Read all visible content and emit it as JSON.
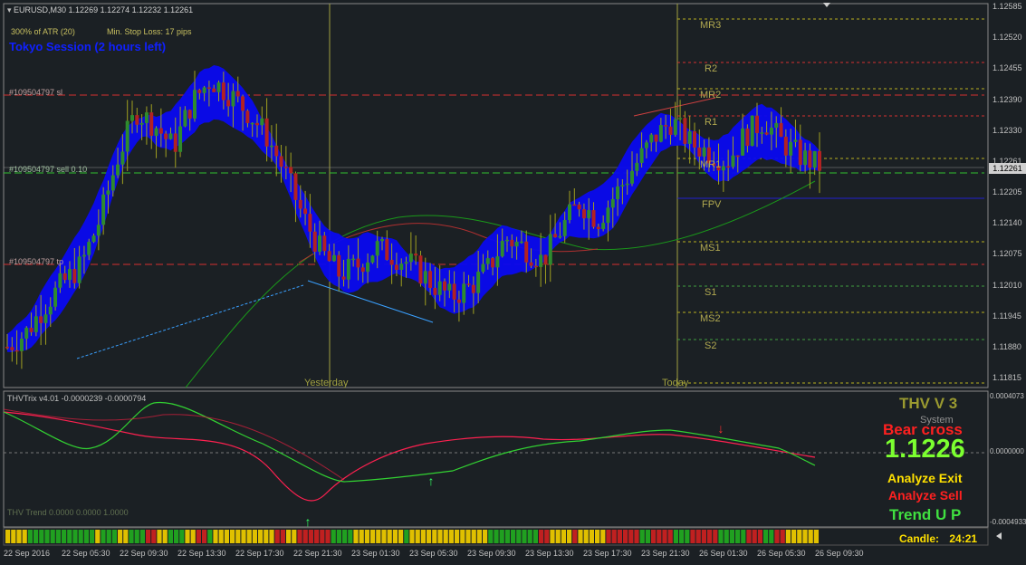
{
  "window": {
    "symbol_header": "EURUSD,M30  1.12269 1.12274 1.12232 1.12261",
    "atr_text": "300% of ATR (20)",
    "stop_loss_text": "Min. Stop Loss:  17 pips",
    "session_text": "Tokyo Session (2 hours left)"
  },
  "orders": {
    "sl_label": "#109504797 sl",
    "sell_label": "#109504797 sell 0.10",
    "tp_label": "#109504797 tp"
  },
  "markers": {
    "yesterday": "Yesterday",
    "today": "Today"
  },
  "pivots": {
    "mr3": "MR3",
    "r2": "R2",
    "mr2": "MR2",
    "r1": "R1",
    "mr1": "MR1",
    "fpv": "FPV",
    "ms1": "MS1",
    "s1": "S1",
    "ms2": "MS2",
    "s2": "S2"
  },
  "price_axis": {
    "ticks": [
      "1.12585",
      "1.12520",
      "1.12455",
      "1.12390",
      "1.12330",
      "1.12261",
      "1.12205",
      "1.12140",
      "1.12075",
      "1.12010",
      "1.11945",
      "1.11880",
      "1.11815"
    ],
    "current_price": "1.12261"
  },
  "indicator": {
    "header": "THVTrix v4.01 -0.0000239 -0.0000794",
    "trend_header": "THV Trend 0.0000 0.0000 1.0000",
    "ticks": [
      "0.0004073",
      "0.0000000",
      "-0.0004933"
    ]
  },
  "panel": {
    "title": "THV V 3",
    "system": "System",
    "signal": "Bear cross",
    "price": "1.1226",
    "analyze_exit": "Analyze Exit",
    "analyze_sell": "Analyze Sell",
    "trend": "Trend U P",
    "candle_label": "Candle:",
    "candle_time": "24:21"
  },
  "time_axis": {
    "labels": [
      "22 Sep 2016",
      "22 Sep 05:30",
      "22 Sep 09:30",
      "22 Sep 13:30",
      "22 Sep 17:30",
      "22 Sep 21:30",
      "23 Sep 01:30",
      "23 Sep 05:30",
      "23 Sep 09:30",
      "23 Sep 13:30",
      "23 Sep 17:30",
      "23 Sep 21:30",
      "26 Sep 01:30",
      "26 Sep 05:30",
      "26 Sep 09:30"
    ]
  },
  "colors": {
    "background": "#1b2024",
    "bull": "#2e8b2e",
    "bear": "#b22222",
    "cloud": "#0a0af0",
    "pivot_red": "#d43030",
    "pivot_yellow": "#b8b020",
    "grid_text": "#b0b0b0",
    "panel_title": "#9a9a30",
    "signal_red": "#ff2020",
    "price_green": "#7cff30",
    "exit_yellow": "#ffe000",
    "trend_green": "#40e040"
  },
  "chart_data": {
    "type": "candlestick",
    "symbol": "EURUSD",
    "timeframe": "M30",
    "ohlc_last": {
      "open": 1.12269,
      "high": 1.12274,
      "low": 1.12232,
      "close": 1.12261
    },
    "ylim": [
      1.1179,
      1.1261
    ],
    "indicator_ylim": [
      -0.0004933,
      0.0004073
    ],
    "close_path": [
      1.1186,
      1.1189,
      1.1195,
      1.12,
      1.1204,
      1.1214,
      1.1228,
      1.1238,
      1.1235,
      1.123,
      1.124,
      1.1245,
      1.1242,
      1.1238,
      1.1233,
      1.1225,
      1.1215,
      1.1207,
      1.1202,
      1.1204,
      1.1208,
      1.1206,
      1.1204,
      1.12,
      1.1197,
      1.1199,
      1.1203,
      1.121,
      1.1208,
      1.1205,
      1.1212,
      1.1218,
      1.1214,
      1.122,
      1.1226,
      1.1232,
      1.1236,
      1.1231,
      1.1229,
      1.1227,
      1.1233,
      1.1236,
      1.1231,
      1.1228,
      1.1226
    ]
  }
}
